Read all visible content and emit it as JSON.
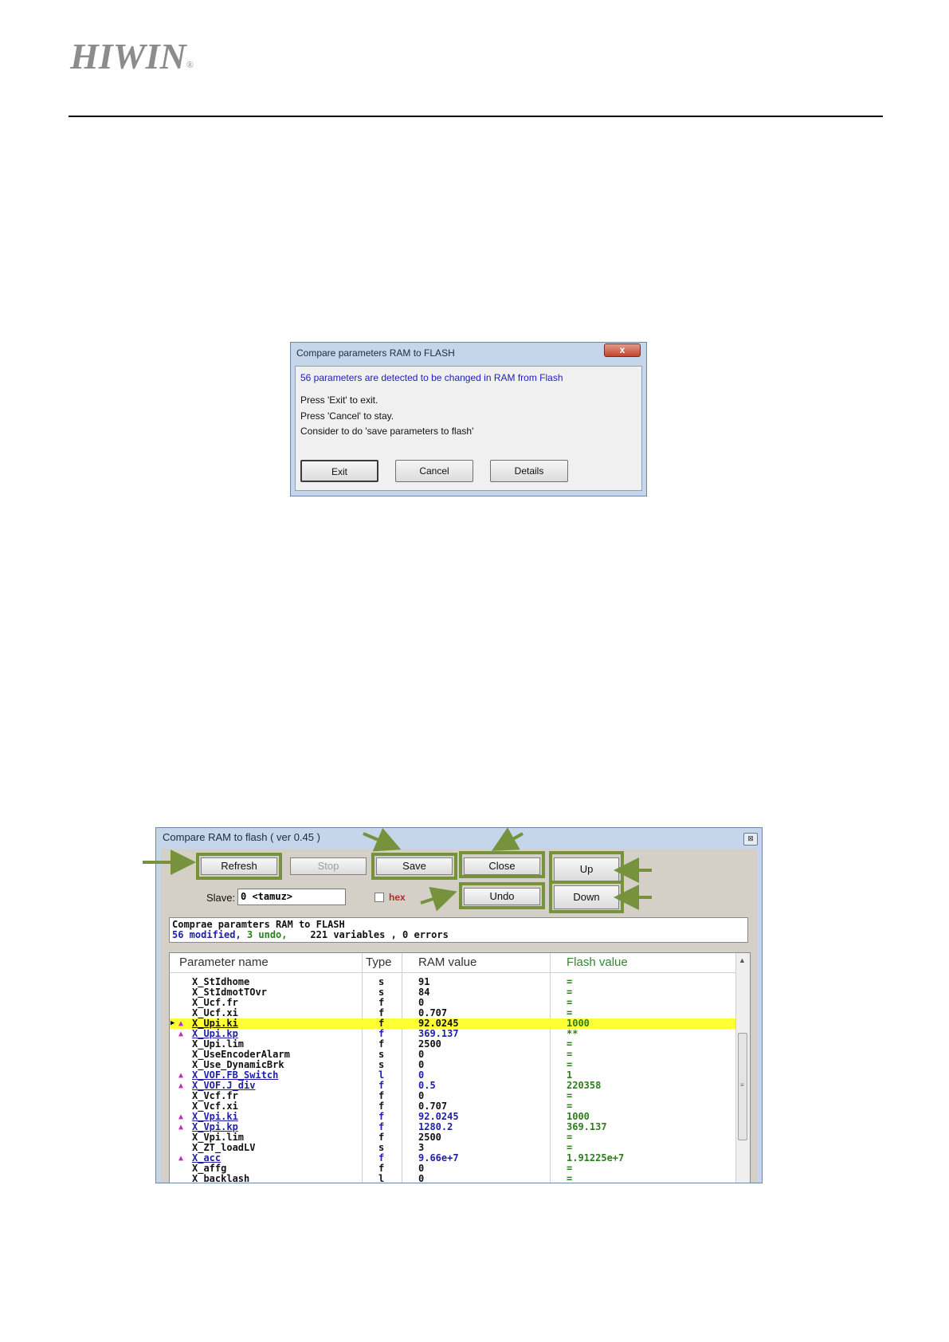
{
  "logo": {
    "text": "HIWIN",
    "mark": "®"
  },
  "dialog_compare": {
    "title": "Compare parameters RAM to FLASH",
    "close_label": "x",
    "message": "56 parameters are detected to be changed in RAM from Flash",
    "line_exit": "Press 'Exit' to exit.",
    "line_cancel": "Press 'Cancel' to stay.",
    "line_consider": "Consider to do 'save parameters to flash'",
    "btn_exit": "Exit",
    "btn_cancel": "Cancel",
    "btn_details": "Details"
  },
  "compare_window": {
    "title": "Compare RAM to flash ( ver 0.45 )",
    "close_label": "⊠",
    "toolbar": {
      "refresh": "Refresh",
      "stop": "Stop",
      "save": "Save",
      "close": "Close",
      "up": "Up",
      "down": "Down",
      "undo": "Undo"
    },
    "slave_label": "Slave:",
    "slave_value": "0 <tamuz>",
    "hex_label": "hex",
    "status_line1": "Comprae paramters RAM to FLASH",
    "status_modified": "56 modified,",
    "status_undo": "3 undo,",
    "status_rest": "221 variables , 0 errors",
    "columns": {
      "name": "Parameter name",
      "type": "Type",
      "ram": "RAM value",
      "flash": "Flash value"
    },
    "rows": [
      {
        "name": "X_StIdhome",
        "type": "s",
        "ram": "91",
        "flash": "=",
        "changed": false
      },
      {
        "name": "X_StIdmotTOvr",
        "type": "s",
        "ram": "84",
        "flash": "=",
        "changed": false
      },
      {
        "name": "X_Ucf.fr",
        "type": "f",
        "ram": "0",
        "flash": "=",
        "changed": false
      },
      {
        "name": "X_Ucf.xi",
        "type": "f",
        "ram": "0.707",
        "flash": "=",
        "changed": false
      },
      {
        "name": "X_Upi.ki",
        "type": "f",
        "ram": "92.0245",
        "flash": "1000",
        "changed": true,
        "selected": true
      },
      {
        "name": "X_Upi.kp",
        "type": "f",
        "ram": "369.137",
        "flash": "**",
        "changed": true
      },
      {
        "name": "X_Upi.lim",
        "type": "f",
        "ram": "2500",
        "flash": "=",
        "changed": false
      },
      {
        "name": "X_UseEncoderAlarm",
        "type": "s",
        "ram": "0",
        "flash": "=",
        "changed": false
      },
      {
        "name": "X_Use_DynamicBrk",
        "type": "s",
        "ram": "0",
        "flash": "=",
        "changed": false
      },
      {
        "name": "X_VOF.FB_Switch",
        "type": "l",
        "ram": "0",
        "flash": "1",
        "changed": true
      },
      {
        "name": "X_VOF.J_div",
        "type": "f",
        "ram": "0.5",
        "flash": "220358",
        "changed": true
      },
      {
        "name": "X_Vcf.fr",
        "type": "f",
        "ram": "0",
        "flash": "=",
        "changed": false
      },
      {
        "name": "X_Vcf.xi",
        "type": "f",
        "ram": "0.707",
        "flash": "=",
        "changed": false
      },
      {
        "name": "X_Vpi.ki",
        "type": "f",
        "ram": "92.0245",
        "flash": "1000",
        "changed": true
      },
      {
        "name": "X_Vpi.kp",
        "type": "f",
        "ram": "1280.2",
        "flash": "369.137",
        "changed": true
      },
      {
        "name": "X_Vpi.lim",
        "type": "f",
        "ram": "2500",
        "flash": "=",
        "changed": false
      },
      {
        "name": "X_ZT_loadLV",
        "type": "s",
        "ram": "3",
        "flash": "=",
        "changed": false
      },
      {
        "name": "X_acc",
        "type": "f",
        "ram": "9.66e+7",
        "flash": "1.91225e+7",
        "changed": true
      },
      {
        "name": "X_affg",
        "type": "f",
        "ram": "0",
        "flash": "=",
        "changed": false
      },
      {
        "name": "X_backlash",
        "type": "l",
        "ram": "0",
        "flash": "=",
        "changed": false
      }
    ]
  },
  "colors": {
    "highlight_frame": "#76923c",
    "selected_row": "#ffff33",
    "changed_text": "#1e1ea8",
    "flash_text": "#2e7d1e",
    "marker": "#c22ac2"
  }
}
